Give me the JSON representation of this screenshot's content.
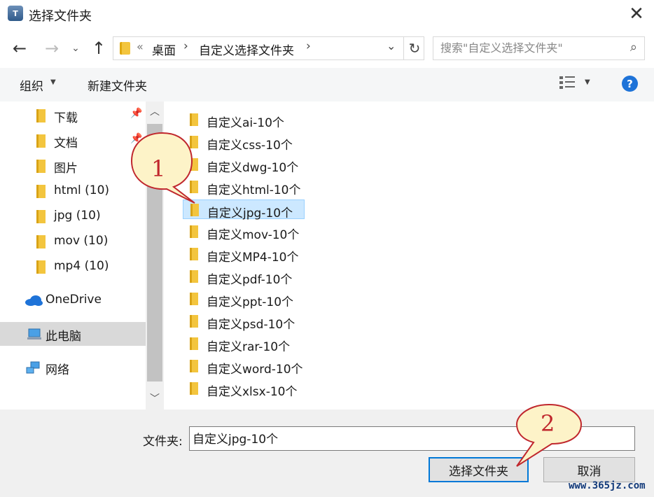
{
  "window": {
    "title": "选择文件夹",
    "app_icon_text": "T"
  },
  "address": {
    "overflow": "«",
    "breadcrumb": [
      "桌面",
      "自定义选择文件夹"
    ],
    "separator": "›"
  },
  "search": {
    "placeholder": "搜索\"自定义选择文件夹\""
  },
  "toolbar": {
    "organize": "组织",
    "new_folder": "新建文件夹",
    "help": "?"
  },
  "nav": {
    "quick": [
      {
        "label": "下载",
        "pinned": true,
        "icon": "download-icon"
      },
      {
        "label": "文档",
        "pinned": true,
        "icon": "document-icon"
      },
      {
        "label": "图片",
        "pinned": false,
        "icon": "picture-icon"
      },
      {
        "label": "html (10)",
        "pinned": false,
        "icon": "folder-icon"
      },
      {
        "label": "jpg (10)",
        "pinned": false,
        "icon": "folder-icon"
      },
      {
        "label": "mov (10)",
        "pinned": false,
        "icon": "folder-icon"
      },
      {
        "label": "mp4 (10)",
        "pinned": false,
        "icon": "folder-icon"
      }
    ],
    "onedrive": "OneDrive",
    "thispc": "此电脑",
    "network": "网络"
  },
  "files": [
    "自定义ai-10个",
    "自定义css-10个",
    "自定义dwg-10个",
    "自定义html-10个",
    "自定义jpg-10个",
    "自定义mov-10个",
    "自定义MP4-10个",
    "自定义pdf-10个",
    "自定义ppt-10个",
    "自定义psd-10个",
    "自定义rar-10个",
    "自定义word-10个",
    "自定义xlsx-10个"
  ],
  "selected_index": 4,
  "footer": {
    "folder_label": "文件夹:",
    "folder_value": "自定义jpg-10个",
    "select_button": "选择文件夹",
    "cancel_button": "取消"
  },
  "callouts": [
    "1",
    "2"
  ],
  "watermark": "www.365jz.com",
  "colors": {
    "accent": "#0078d7",
    "selection": "#cce8ff",
    "folder": "#f3c53e",
    "callout_fill": "#fdf3c8",
    "callout_border": "#c0272d"
  }
}
